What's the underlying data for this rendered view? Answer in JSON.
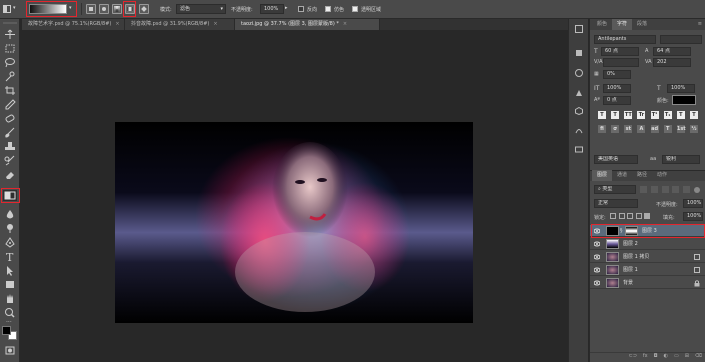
{
  "options_bar": {
    "mode_label": "模式:",
    "mode_value": "滤色",
    "opacity_label": "不透明度:",
    "opacity_value": "100%",
    "reverse_label": "反向",
    "dither_label": "仿色",
    "transparency_label": "透明区域",
    "reverse_checked": false,
    "dither_checked": true,
    "transparency_checked": true
  },
  "tabs": [
    {
      "label": "故障艺术字.psd @ 75.1%(RGB/8#)",
      "active": false
    },
    {
      "label": "抖音故障.psd @ 31.9%(RGB/8#)",
      "active": false
    },
    {
      "label": "taozi.jpg @ 37.7% (图层 3, 图层蒙版/8) *",
      "active": true
    }
  ],
  "character_panel": {
    "tabs": [
      "颜色",
      "字符",
      "段落"
    ],
    "font_family": "Antilepants",
    "font_size": "60 点",
    "leading": "64 点",
    "tracking": "202",
    "kerning_scale": "0%",
    "vertical_scale": "100%",
    "horizontal_scale": "100%",
    "baseline": "0 点",
    "color_label": "颜色:",
    "language": "美国英语",
    "antialias": "锐利",
    "text_buttons": [
      "T",
      "T",
      "TT",
      "Tr",
      "T¹",
      "T₁",
      "T",
      "T"
    ],
    "feature_buttons": [
      "fi",
      "σ",
      "st",
      "A",
      "ad",
      "T",
      "1st",
      "½"
    ]
  },
  "layers_panel": {
    "tabs": [
      "图层",
      "通道",
      "路径",
      "动作"
    ],
    "filter_kind": "类型",
    "blend_mode": "正常",
    "opacity_label": "不透明度:",
    "opacity_value": "100%",
    "lock_label": "锁定:",
    "fill_label": "填充:",
    "fill_value": "100%",
    "layers": [
      {
        "name": "图层 3",
        "selected": true,
        "has_mask": true
      },
      {
        "name": "图层 2",
        "selected": false,
        "has_mask": false
      },
      {
        "name": "图层 1 拷贝",
        "selected": false,
        "has_mask": false
      },
      {
        "name": "图层 1",
        "selected": false,
        "has_mask": false
      },
      {
        "name": "背景",
        "selected": false,
        "has_mask": false
      }
    ]
  },
  "colors": {
    "highlight": "#e3262e",
    "foreground": "#000000",
    "background": "#ffffff"
  }
}
